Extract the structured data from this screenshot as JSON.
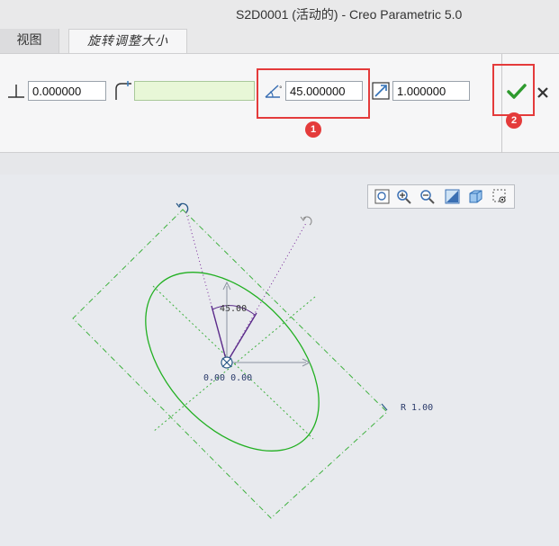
{
  "window": {
    "title": "S2D0001 (活动的) - Creo Parametric 5.0"
  },
  "tabs": [
    {
      "label": "视图"
    },
    {
      "label": "旋转调整大小"
    }
  ],
  "toolbar": {
    "offset_value": "0.000000",
    "reference_value": "",
    "angle_value": "45.000000",
    "scale_value": "1.000000"
  },
  "callouts": [
    {
      "label": "1"
    },
    {
      "label": "2"
    }
  ],
  "canvas": {
    "angle_dim": "45.00",
    "origin_coords": "0.00 0.00",
    "scale_label": "R 1.00"
  },
  "colors": {
    "ellipse": "#22b022",
    "bbox": "#3fb13f",
    "angle_lines": "#7a2a9a",
    "callout": "#e43b3b",
    "ok": "#2e9a2e"
  }
}
